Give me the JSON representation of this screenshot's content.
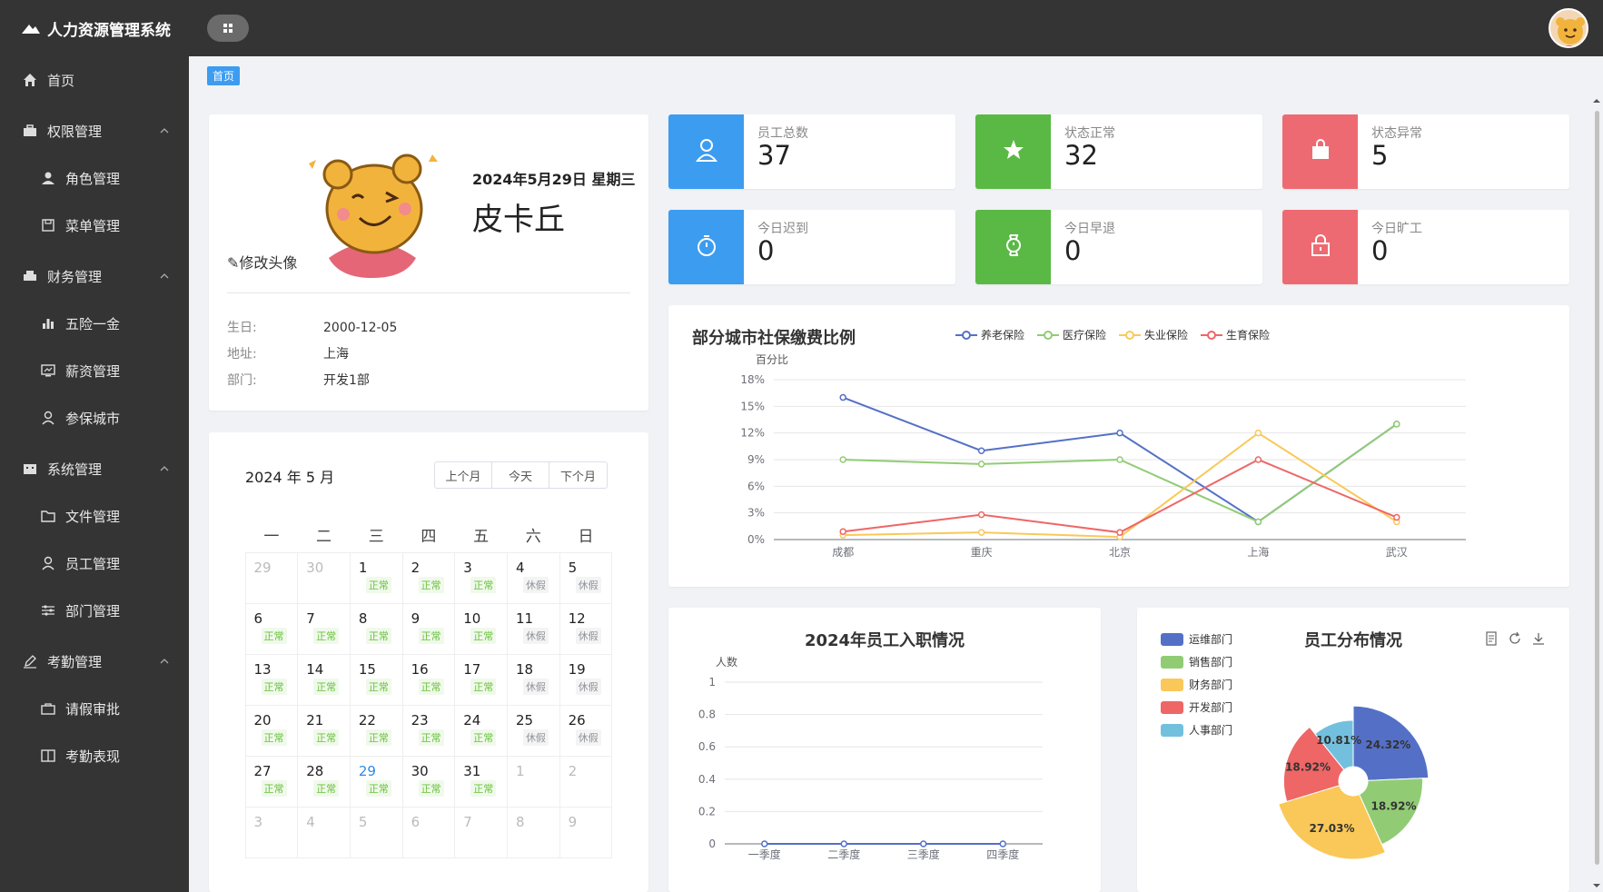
{
  "app": {
    "title": "人力资源管理系统"
  },
  "sidebar": {
    "items": [
      {
        "label": "首页"
      },
      {
        "label": "权限管理"
      },
      {
        "label": "角色管理"
      },
      {
        "label": "菜单管理"
      },
      {
        "label": "财务管理"
      },
      {
        "label": "五险一金"
      },
      {
        "label": "薪资管理"
      },
      {
        "label": "参保城市"
      },
      {
        "label": "系统管理"
      },
      {
        "label": "文件管理"
      },
      {
        "label": "员工管理"
      },
      {
        "label": "部门管理"
      },
      {
        "label": "考勤管理"
      },
      {
        "label": "请假审批"
      },
      {
        "label": "考勤表现"
      }
    ]
  },
  "breadcrumb": {
    "home": "首页"
  },
  "profile": {
    "date": "2024年5月29日 星期三",
    "name": "皮卡丘",
    "edit_avatar": "修改头像",
    "birthday_label": "生日:",
    "birthday": "2000-12-05",
    "address_label": "地址:",
    "address": "上海",
    "dept_label": "部门:",
    "dept": "开发1部"
  },
  "calendar": {
    "title": "2024 年 5 月",
    "prev": "上个月",
    "today": "今天",
    "next": "下个月",
    "weekdays": [
      "一",
      "二",
      "三",
      "四",
      "五",
      "六",
      "日"
    ],
    "cells": [
      {
        "d": "29",
        "o": true,
        "t": ""
      },
      {
        "d": "30",
        "o": true,
        "t": ""
      },
      {
        "d": "1",
        "t": "正常"
      },
      {
        "d": "2",
        "t": "正常"
      },
      {
        "d": "3",
        "t": "正常"
      },
      {
        "d": "4",
        "t": "休假"
      },
      {
        "d": "5",
        "t": "休假"
      },
      {
        "d": "6",
        "t": "正常"
      },
      {
        "d": "7",
        "t": "正常"
      },
      {
        "d": "8",
        "t": "正常"
      },
      {
        "d": "9",
        "t": "正常"
      },
      {
        "d": "10",
        "t": "正常"
      },
      {
        "d": "11",
        "t": "休假"
      },
      {
        "d": "12",
        "t": "休假"
      },
      {
        "d": "13",
        "t": "正常"
      },
      {
        "d": "14",
        "t": "正常"
      },
      {
        "d": "15",
        "t": "正常"
      },
      {
        "d": "16",
        "t": "正常"
      },
      {
        "d": "17",
        "t": "正常"
      },
      {
        "d": "18",
        "t": "休假"
      },
      {
        "d": "19",
        "t": "休假"
      },
      {
        "d": "20",
        "t": "正常"
      },
      {
        "d": "21",
        "t": "正常"
      },
      {
        "d": "22",
        "t": "正常"
      },
      {
        "d": "23",
        "t": "正常"
      },
      {
        "d": "24",
        "t": "正常"
      },
      {
        "d": "25",
        "t": "休假"
      },
      {
        "d": "26",
        "t": "休假"
      },
      {
        "d": "27",
        "t": "正常"
      },
      {
        "d": "28",
        "t": "正常"
      },
      {
        "d": "29",
        "t": "正常",
        "today": true
      },
      {
        "d": "30",
        "t": "正常"
      },
      {
        "d": "31",
        "t": "正常"
      },
      {
        "d": "1",
        "o": true,
        "t": ""
      },
      {
        "d": "2",
        "o": true,
        "t": ""
      },
      {
        "d": "3",
        "o": true,
        "t": ""
      },
      {
        "d": "4",
        "o": true,
        "t": ""
      },
      {
        "d": "5",
        "o": true,
        "t": ""
      },
      {
        "d": "6",
        "o": true,
        "t": ""
      },
      {
        "d": "7",
        "o": true,
        "t": ""
      },
      {
        "d": "8",
        "o": true,
        "t": ""
      },
      {
        "d": "9",
        "o": true,
        "t": ""
      }
    ]
  },
  "stats": [
    {
      "label": "员工总数",
      "value": "37",
      "color": "#3c9cf0",
      "icon": "user-icon"
    },
    {
      "label": "状态正常",
      "value": "32",
      "color": "#5ab945",
      "icon": "star-icon"
    },
    {
      "label": "状态异常",
      "value": "5",
      "color": "#ee6a72",
      "icon": "bag-icon"
    },
    {
      "label": "今日迟到",
      "value": "0",
      "color": "#3c9cf0",
      "icon": "stopwatch-icon"
    },
    {
      "label": "今日早退",
      "value": "0",
      "color": "#5ab945",
      "icon": "watch-icon"
    },
    {
      "label": "今日旷工",
      "value": "0",
      "color": "#ee6a72",
      "icon": "lock-icon"
    }
  ],
  "chart_data": [
    {
      "type": "line",
      "title": "部分城市社保缴费比例",
      "ylabel": "百分比",
      "categories": [
        "成都",
        "重庆",
        "北京",
        "上海",
        "武汉"
      ],
      "ylim": [
        0,
        18
      ],
      "yticks": [
        "0%",
        "3%",
        "6%",
        "9%",
        "12%",
        "15%",
        "18%"
      ],
      "series": [
        {
          "name": "养老保险",
          "color": "#5470c6",
          "values": [
            16,
            10,
            12,
            2,
            13
          ]
        },
        {
          "name": "医疗保险",
          "color": "#91cc75",
          "values": [
            9,
            8.5,
            9,
            2,
            13
          ]
        },
        {
          "name": "失业保险",
          "color": "#fac858",
          "values": [
            0.5,
            0.8,
            0.3,
            12,
            2
          ]
        },
        {
          "name": "生育保险",
          "color": "#ee6666",
          "values": [
            0.9,
            2.8,
            0.8,
            9,
            2.5
          ]
        }
      ]
    },
    {
      "type": "line",
      "title": "2024年员工入职情况",
      "ylabel": "人数",
      "categories": [
        "一季度",
        "二季度",
        "三季度",
        "四季度"
      ],
      "ylim": [
        0,
        1
      ],
      "yticks": [
        "0",
        "0.2",
        "0.4",
        "0.6",
        "0.8",
        "1"
      ],
      "series": [
        {
          "color": "#5470c6",
          "values": [
            0,
            0,
            0,
            0
          ]
        }
      ]
    },
    {
      "type": "pie",
      "title": "员工分布情况",
      "legend_position": "top-left",
      "categories": [
        "运维部门",
        "销售部门",
        "财务部门",
        "开发部门",
        "人事部门"
      ],
      "values": [
        24.32,
        18.92,
        27.03,
        18.92,
        10.81
      ],
      "labels": [
        "24.32%",
        "18.92%",
        "27.03%",
        "18.92%",
        "10.81%"
      ],
      "colors": [
        "#5470c6",
        "#91cc75",
        "#fac858",
        "#ee6666",
        "#73c0de"
      ]
    }
  ]
}
